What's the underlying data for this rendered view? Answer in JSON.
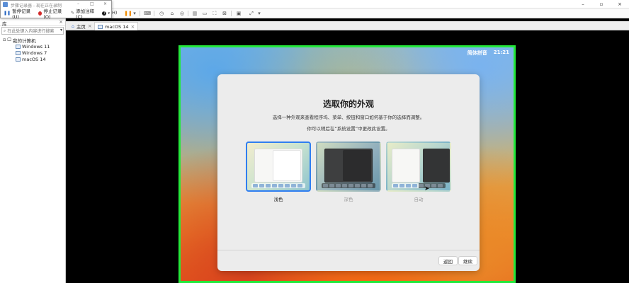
{
  "recorder": {
    "title": "步骤记录器 - 现在正在录制",
    "pause_label": "暂停记录(U)",
    "stop_label": "停止记录(O)",
    "comment_label": "添加注释(C)",
    "help_icon": "help-icon",
    "minimize": "–",
    "restore": "□",
    "close": "×"
  },
  "host_window": {
    "menu_fragment": "H)",
    "controls": {
      "minimize": "–",
      "maximize": "▫",
      "close": "×"
    }
  },
  "library": {
    "title": "库",
    "search_placeholder": "在此处键入内容进行搜索",
    "tree": [
      {
        "label": "我的计算机",
        "level": 0,
        "expanded": true
      },
      {
        "label": "Windows 11",
        "level": 1
      },
      {
        "label": "Windows 7",
        "level": 1
      },
      {
        "label": "macOS 14",
        "level": 1
      }
    ]
  },
  "tabs": [
    {
      "label": "主页",
      "icon": "home-icon",
      "active": false
    },
    {
      "label": "macOS 14",
      "icon": "vm-icon",
      "active": true
    }
  ],
  "guest": {
    "menubar": {
      "input_method": "简体拼音",
      "time": "21:21"
    },
    "dialog": {
      "title": "选取你的外观",
      "description": "选择一种外观来查看程序坞、菜单、按钮和窗口如何基于你的选择而调整。",
      "note": "你可以稍后在“系统设置”中更改此设置。",
      "options": [
        {
          "label": "浅色",
          "selected": true
        },
        {
          "label": "深色",
          "selected": false
        },
        {
          "label": "自动",
          "selected": false
        }
      ],
      "back_label": "返回",
      "continue_label": "继续"
    }
  },
  "colors": {
    "selection_border": "#2f7ef0",
    "guest_border": "#23e83a",
    "pause_orange": "#f08c00"
  }
}
